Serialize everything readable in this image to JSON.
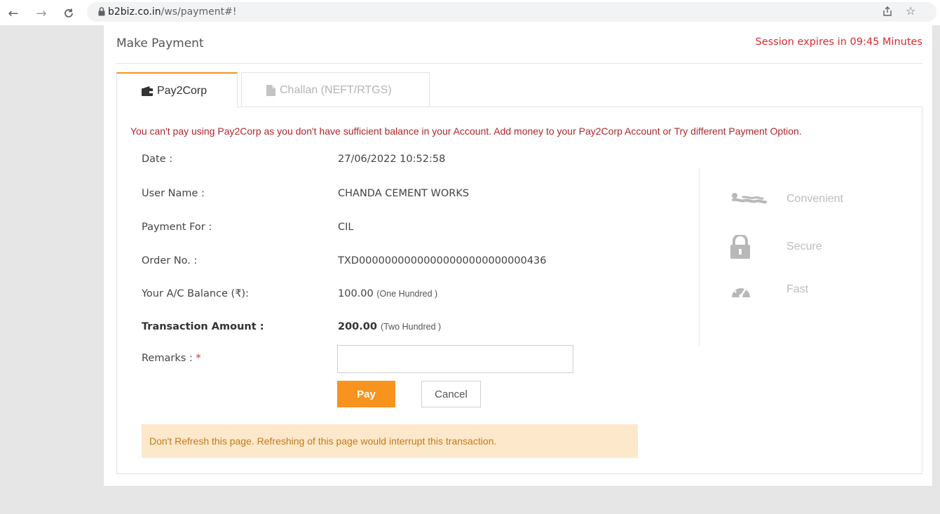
{
  "browser": {
    "url_host": "b2biz.co.in",
    "url_path": "/ws/payment#!"
  },
  "page": {
    "title": "Make Payment",
    "session": "Session expires in 09:45 Minutes"
  },
  "tabs": [
    {
      "label": "Pay2Corp",
      "active": true
    },
    {
      "label": "Challan (NEFT/RTGS)",
      "active": false
    }
  ],
  "error_message": "You can't pay using Pay2Corp as you don't have sufficient balance in your Account. Add money to your Pay2Corp Account or Try different Payment Option.",
  "details": {
    "date_label": "Date :",
    "date_value": "27/06/2022 10:52:58",
    "user_label": "User Name :",
    "user_value": "CHANDA CEMENT WORKS",
    "payment_for_label": "Payment For :",
    "payment_for_value": "CIL",
    "order_label": "Order No. :",
    "order_value": "TXD00000000000000000000000000436",
    "balance_label": "Your A/C Balance (₹):",
    "balance_value": "100.00",
    "balance_words": "(One Hundred )",
    "amount_label": "Transaction Amount :",
    "amount_value": "200.00",
    "amount_words": "(Two Hundred )",
    "remarks_label": "Remarks :",
    "remarks_required": "*",
    "remarks_value": ""
  },
  "buttons": {
    "pay": "Pay",
    "cancel": "Cancel"
  },
  "warning": "Don't Refresh this page. Refreshing of this page would interrupt this transaction.",
  "features": [
    {
      "label": "Convenient",
      "icon": "convenient-icon"
    },
    {
      "label": "Secure",
      "icon": "lock-icon"
    },
    {
      "label": "Fast",
      "icon": "speedometer-icon"
    }
  ],
  "colors": {
    "accent": "#f7931e",
    "session": "#d9292d",
    "error": "#b0262b",
    "warning_bg": "#fde8cc"
  }
}
